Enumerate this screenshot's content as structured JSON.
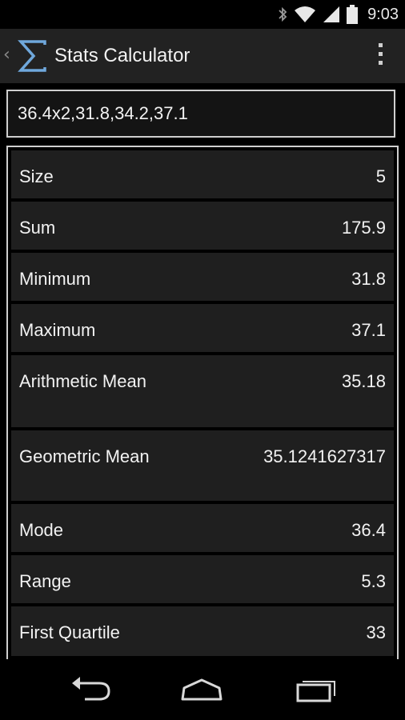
{
  "status_bar": {
    "time": "9:03",
    "icons": [
      "bluetooth-icon",
      "wifi-icon",
      "signal-icon",
      "battery-icon"
    ]
  },
  "action_bar": {
    "title": "Stats Calculator",
    "app_icon": "sigma-icon",
    "overflow_icon": "overflow-menu-icon"
  },
  "input": {
    "value": "36.4x2,31.8,34.2,37.1"
  },
  "results": [
    {
      "label": "Size",
      "value": "5"
    },
    {
      "label": "Sum",
      "value": "175.9"
    },
    {
      "label": "Minimum",
      "value": "31.8"
    },
    {
      "label": "Maximum",
      "value": "37.1"
    },
    {
      "label": "Arithmetic Mean",
      "value": "35.18"
    },
    {
      "label": "Geometric Mean",
      "value": "35.1241627317"
    },
    {
      "label": "Mode",
      "value": "36.4"
    },
    {
      "label": "Range",
      "value": "5.3"
    },
    {
      "label": "First Quartile",
      "value": "33"
    }
  ],
  "nav_bar": {
    "buttons": [
      "back-icon",
      "home-icon",
      "recent-apps-icon"
    ]
  },
  "colors": {
    "action_bar_bg": "#222222",
    "row_bg": "#1f1f1f",
    "border": "#cfcfcf",
    "text": "#f2f2f2",
    "icon_blue": "#6fa8dc"
  }
}
